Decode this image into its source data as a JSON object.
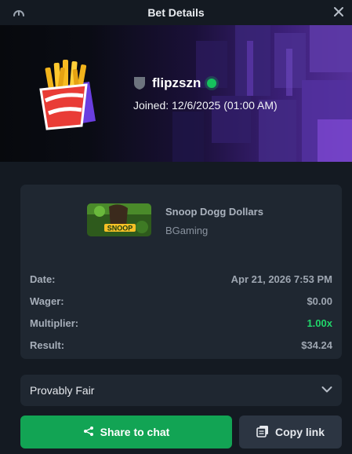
{
  "header": {
    "title": "Bet Details",
    "left_icon": "speedometer-icon",
    "close_icon": "close-icon"
  },
  "profile": {
    "username": "flipzszn",
    "joined": "Joined: 12/6/2025 (01:00 AM)",
    "status": "online",
    "rank_icon": "shield-icon",
    "avatar": "french-fries-icon"
  },
  "game": {
    "name": "Snoop Dogg Dollars",
    "provider": "BGaming",
    "thumbnail_text": "SNOOP"
  },
  "details": [
    {
      "label": "Date:",
      "value": "Apr 21, 2026 7:53 PM"
    },
    {
      "label": "Wager:",
      "value": "$0.00"
    },
    {
      "label": "Multiplier:",
      "value": "1.00x"
    },
    {
      "label": "Result:",
      "value": "$34.24"
    }
  ],
  "provably_fair": {
    "label": "Provably Fair",
    "icon": "chevron-down-icon"
  },
  "actions": {
    "share_label": "Share to chat",
    "share_icon": "share-icon",
    "copy_label": "Copy link",
    "copy_icon": "copy-icon"
  },
  "colors": {
    "background": "#141a22",
    "card": "#1f2731",
    "accent_green": "#12a454",
    "multiplier_green": "#20d76a",
    "online": "#16c25d"
  }
}
